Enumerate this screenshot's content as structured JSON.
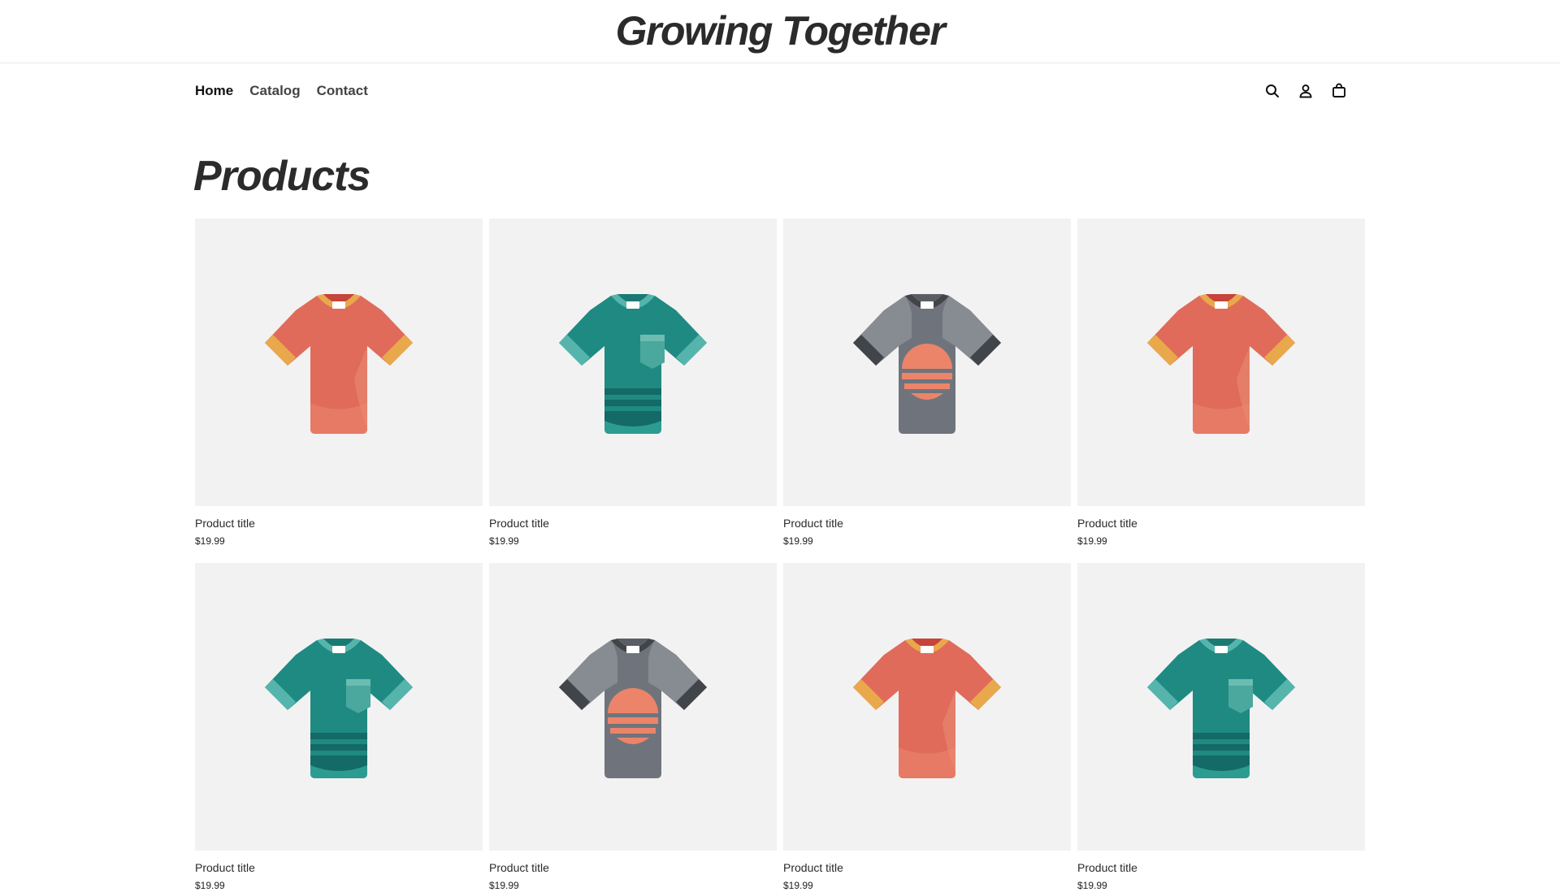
{
  "store": {
    "name": "Growing Together"
  },
  "nav": {
    "items": [
      {
        "label": "Home",
        "active": true
      },
      {
        "label": "Catalog",
        "active": false
      },
      {
        "label": "Contact",
        "active": false
      }
    ]
  },
  "header_icons": [
    "search-icon",
    "account-icon",
    "cart-icon"
  ],
  "page": {
    "heading": "Products"
  },
  "products": [
    {
      "title": "Product title",
      "price": "$19.99",
      "style": "coral"
    },
    {
      "title": "Product title",
      "price": "$19.99",
      "style": "teal"
    },
    {
      "title": "Product title",
      "price": "$19.99",
      "style": "gray"
    },
    {
      "title": "Product title",
      "price": "$19.99",
      "style": "coral"
    },
    {
      "title": "Product title",
      "price": "$19.99",
      "style": "teal"
    },
    {
      "title": "Product title",
      "price": "$19.99",
      "style": "gray"
    },
    {
      "title": "Product title",
      "price": "$19.99",
      "style": "coral"
    },
    {
      "title": "Product title",
      "price": "$19.99",
      "style": "teal"
    }
  ],
  "colors": {
    "thumb_bg": "#f2f2f2",
    "coral_body": "#e06b5a",
    "coral_trim": "#e9a84b",
    "teal_body": "#1f8a82",
    "teal_trim": "#55b5ad",
    "gray_body": "#6f747c",
    "gray_trim": "#414448",
    "gray_graphic": "#ec8469"
  }
}
